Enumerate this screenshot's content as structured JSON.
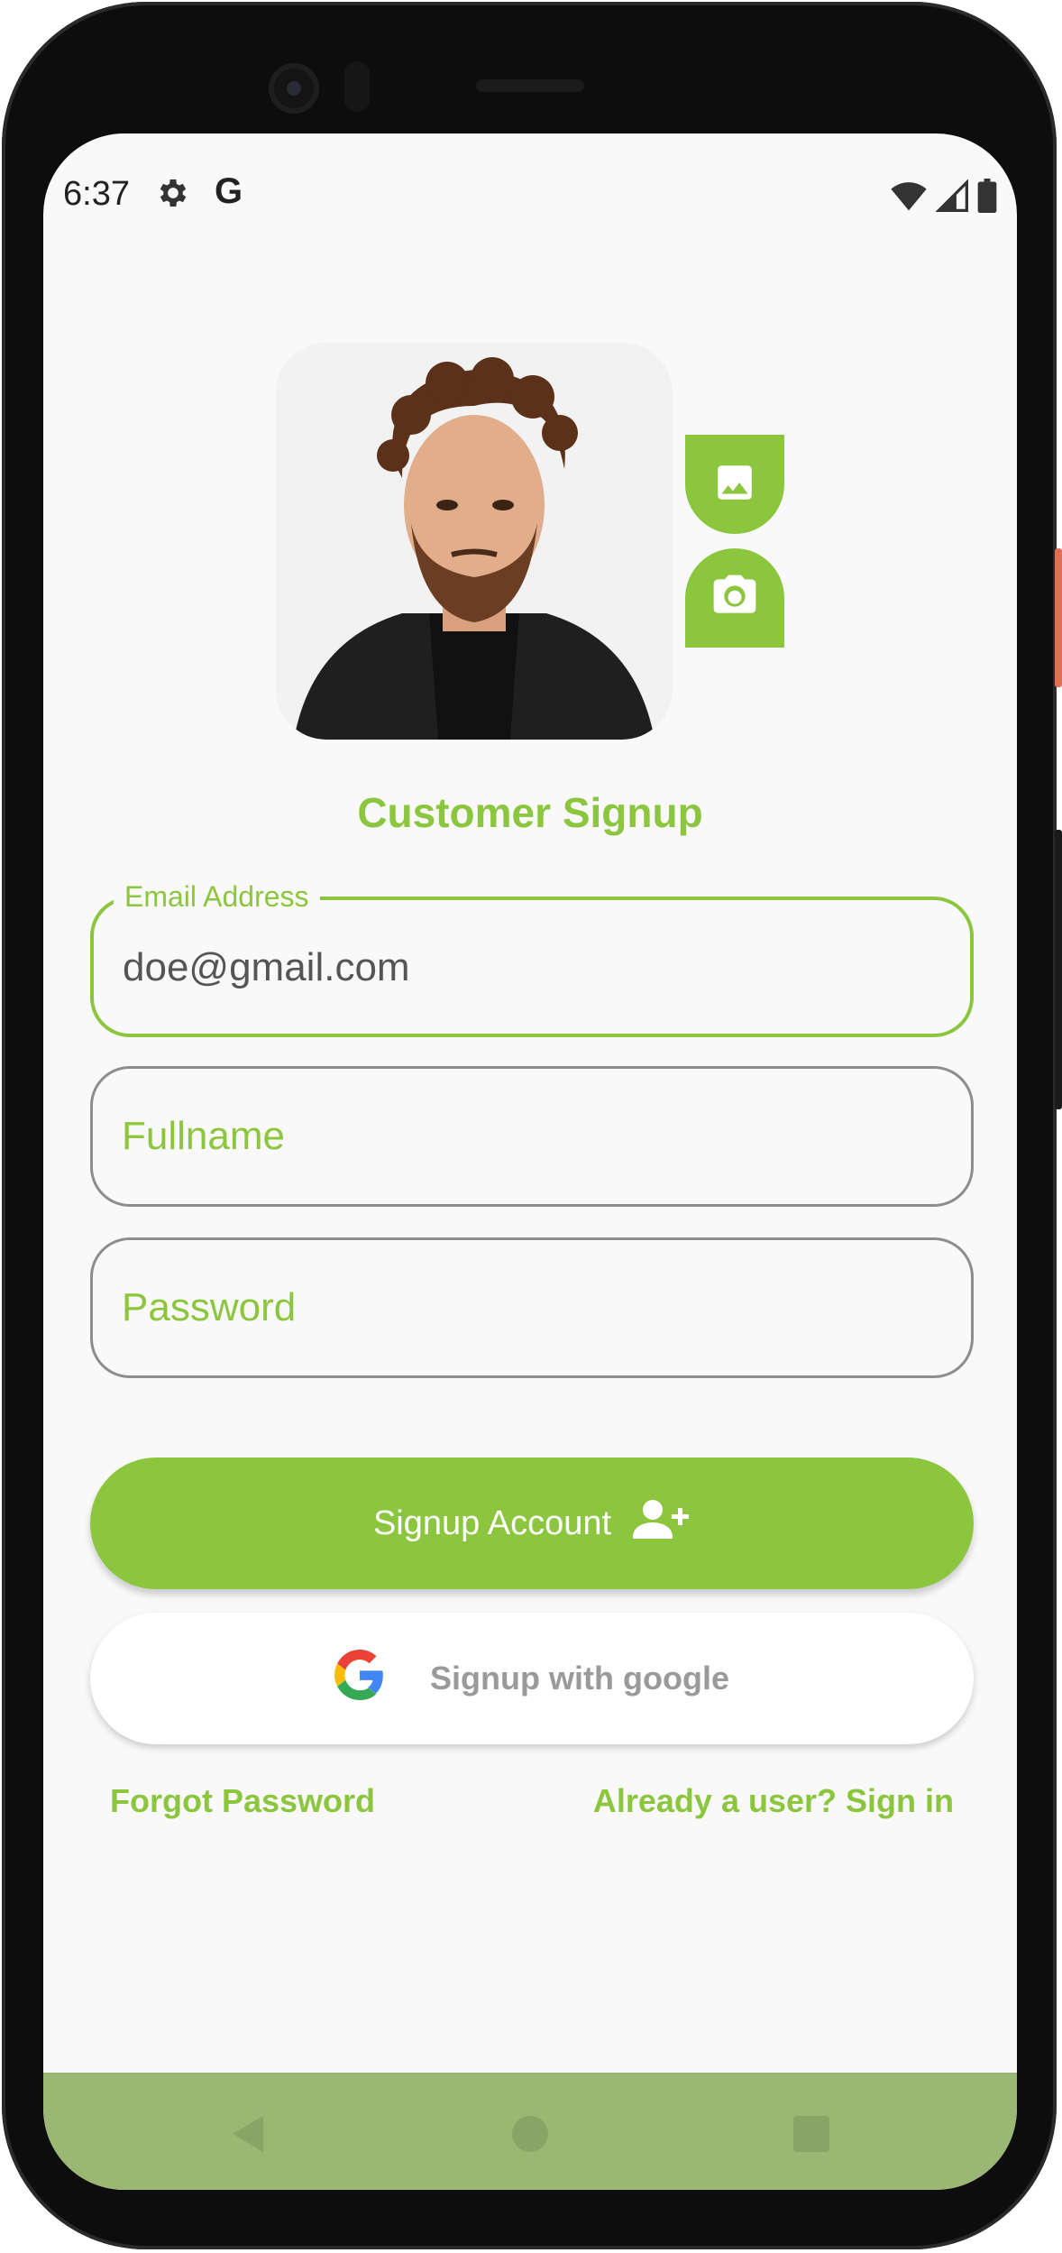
{
  "status_bar": {
    "time": "6:37",
    "left_icons": [
      "gear-icon",
      "google-g-icon"
    ],
    "google_letter": "G",
    "right_icons": [
      "wifi-icon",
      "signal-icon",
      "battery-icon"
    ]
  },
  "profile": {
    "avatar_alt": "profile-photo",
    "gallery_icon": "image-icon",
    "camera_icon": "camera-icon"
  },
  "form": {
    "title": "Customer Signup",
    "email": {
      "label": "Email Address",
      "value": "doe@gmail.com"
    },
    "fullname": {
      "placeholder": "Fullname"
    },
    "password": {
      "placeholder": "Password"
    }
  },
  "actions": {
    "signup_label": "Signup Account",
    "signup_icon": "person-add-icon",
    "google_label": "Signup with google",
    "google_icon": "google-logo-icon",
    "forgot_label": "Forgot Password",
    "signin_label": "Already a user? Sign in"
  },
  "navigation": {
    "items": [
      "back-icon",
      "home-icon",
      "recents-icon"
    ]
  },
  "colors": {
    "accent": "#8cc63f",
    "nav_bar": "#9bb774",
    "background": "#f9f9f9"
  }
}
